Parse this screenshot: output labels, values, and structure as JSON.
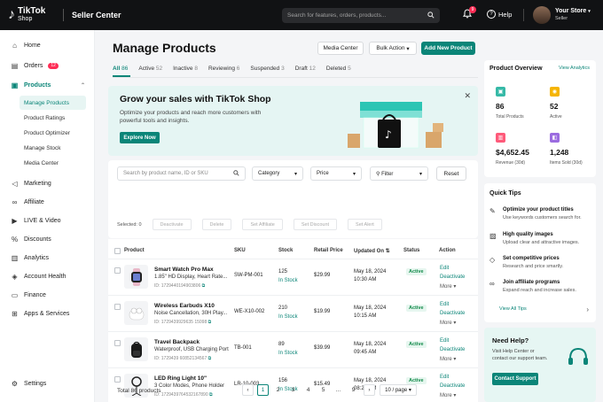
{
  "topbar": {
    "logo_main": "TikTok",
    "logo_sub": "Shop",
    "product": "Seller Center",
    "search_placeholder": "Search for features, orders, products...",
    "notif_count": "9",
    "help_label": "Help",
    "store_name": "Your Store",
    "store_role": "Seller"
  },
  "sidebar": {
    "items": [
      {
        "label": "Home",
        "icon": "home-icon"
      },
      {
        "label": "Orders",
        "icon": "orders-icon",
        "badge": "12"
      },
      {
        "label": "Products",
        "icon": "products-icon"
      },
      {
        "label": "Marketing",
        "icon": "marketing-icon"
      },
      {
        "label": "Affiliate",
        "icon": "affiliate-icon"
      },
      {
        "label": "LIVE & Video",
        "icon": "live-icon"
      },
      {
        "label": "Discounts",
        "icon": "discounts-icon"
      },
      {
        "label": "Analytics",
        "icon": "analytics-icon"
      },
      {
        "label": "Account Health",
        "icon": "health-icon"
      },
      {
        "label": "Finance",
        "icon": "finance-icon"
      },
      {
        "label": "Apps & Services",
        "icon": "apps-icon"
      }
    ],
    "product_sub": [
      "Manage Products",
      "Product Ratings",
      "Product Optimizer",
      "Manage Stock",
      "Media Center"
    ],
    "settings": "Settings"
  },
  "main": {
    "title": "Manage Products",
    "media_center": "Media Center",
    "bulk_action": "Bulk Action",
    "add_new": "Add New Product",
    "tabs": [
      {
        "label": "All",
        "count": "86"
      },
      {
        "label": "Active",
        "count": "52"
      },
      {
        "label": "Inactive",
        "count": "8"
      },
      {
        "label": "Reviewing",
        "count": "6"
      },
      {
        "label": "Suspended",
        "count": "3"
      },
      {
        "label": "Draft",
        "count": "12"
      },
      {
        "label": "Deleted",
        "count": "5"
      }
    ],
    "banner": {
      "title": "Grow your sales with TikTok Shop",
      "desc": "Optimize your products and reach more customers with powerful tools and insights.",
      "button": "Explore Now"
    },
    "filters": {
      "search_placeholder": "Search by product name, ID or SKU",
      "category": "Category",
      "price": "Price",
      "filter": "Filter",
      "reset": "Reset",
      "selected": "Selected: 0",
      "bulk": [
        "Deactivate",
        "Delete",
        "Set Affiliate",
        "Set Discount",
        "Set Alert"
      ]
    },
    "table": {
      "headers": [
        "Product",
        "SKU",
        "Stock",
        "Retail Price",
        "Updated On",
        "Status",
        "Action"
      ],
      "rows": [
        {
          "name": "Smart Watch Pro Max",
          "desc": "1.85\" HD Display, Heart Rate...",
          "id": "ID: 1729440194903806",
          "sku": "SW-PM-001",
          "stock": "125",
          "stock_status": "In Stock",
          "price": "$29.99",
          "date": "May 18, 2024",
          "time": "10:30 AM",
          "status": "Active"
        },
        {
          "name": "Wireless Earbuds X10",
          "desc": "Noise Cancellation, 30H Play...",
          "id": "ID: 1729439929635 15098",
          "sku": "WE-X10-002",
          "stock": "210",
          "stock_status": "In Stock",
          "price": "$19.99",
          "date": "May 18, 2024",
          "time": "10:15 AM",
          "status": "Active"
        },
        {
          "name": "Travel Backpack",
          "desc": "Waterproof, USB Charging Port",
          "id": "ID: 1729439 60852134567",
          "sku": "TB-001",
          "stock": "89",
          "stock_status": "In Stock",
          "price": "$39.99",
          "date": "May 18, 2024",
          "time": "09:45 AM",
          "status": "Active"
        },
        {
          "name": "LED Ring Light 10\"",
          "desc": "3 Color Modes, Phone Holder",
          "id": "ID: 1729439764532167890",
          "sku": "LR-10-003",
          "stock": "156",
          "stock_status": "In Stock",
          "price": "$15.49",
          "date": "May 18, 2024",
          "time": "08:20 AM",
          "status": "Active"
        }
      ],
      "actions": {
        "edit": "Edit",
        "deactivate": "Deactivate",
        "more": "More"
      }
    },
    "pagination": {
      "total": "Total 86 products",
      "pages": [
        "1",
        "2",
        "3",
        "4",
        "5",
        "...",
        "9"
      ],
      "per_page": "10 / page"
    }
  },
  "overview": {
    "title": "Product Overview",
    "link": "View Analytics",
    "stats": [
      {
        "value": "86",
        "label": "Total Products",
        "color": "#36b9a7"
      },
      {
        "value": "52",
        "label": "Active",
        "color": "#f5b400"
      },
      {
        "value": "$4,652.45",
        "label": "Revenue (30d)",
        "color": "#fe5a7a"
      },
      {
        "value": "1,248",
        "label": "Items Sold (30d)",
        "color": "#9b6ce0"
      }
    ]
  },
  "tips": {
    "title": "Quick Tips",
    "items": [
      {
        "title": "Optimize your product titles",
        "desc": "Use keywords customers search for."
      },
      {
        "title": "High quality images",
        "desc": "Upload clear and attractive images."
      },
      {
        "title": "Set competitive prices",
        "desc": "Research and price smartly."
      },
      {
        "title": "Join affiliate programs",
        "desc": "Expand reach and increase sales."
      }
    ],
    "view_all": "View All Tips"
  },
  "help_card": {
    "title": "Need Help?",
    "desc_line1": "Visit Help Center or",
    "desc_line2": "contact our support team.",
    "button": "Contact Support"
  },
  "colors": {
    "accent": "#0b8578",
    "brand_red": "#fe2c55"
  }
}
